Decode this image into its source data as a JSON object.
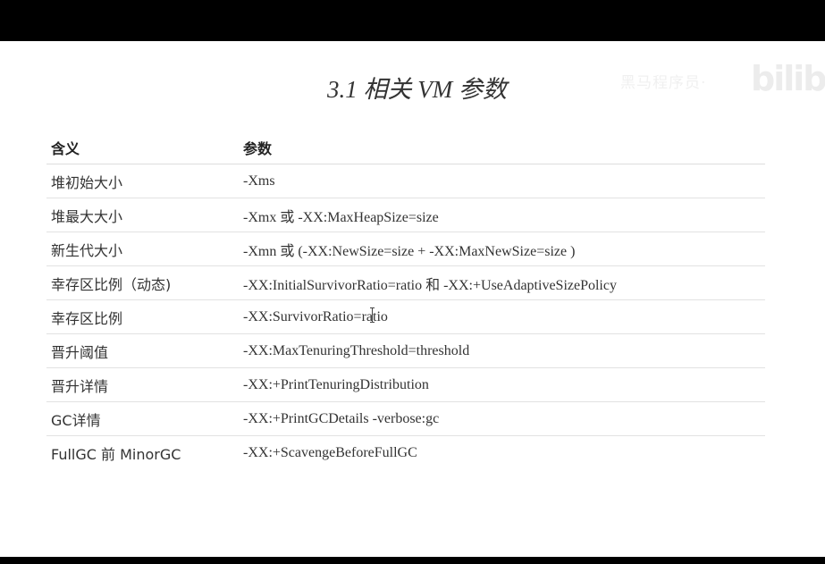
{
  "watermark": {
    "text": "黑马程序员·",
    "logo": "bilibili"
  },
  "title": "3.1 相关 VM 参数",
  "table": {
    "headers": [
      "含义",
      "参数"
    ],
    "rows": [
      {
        "meaning": "堆初始大小",
        "param": "-Xms"
      },
      {
        "meaning": "堆最大大小",
        "param": "-Xmx 或 -XX:MaxHeapSize=size"
      },
      {
        "meaning": "新生代大小",
        "param": "-Xmn 或 (-XX:NewSize=size + -XX:MaxNewSize=size )"
      },
      {
        "meaning": "幸存区比例（动态)",
        "param": "-XX:InitialSurvivorRatio=ratio 和 -XX:+UseAdaptiveSizePolicy"
      },
      {
        "meaning": "幸存区比例",
        "param": "-XX:SurvivorRatio=ratio"
      },
      {
        "meaning": "晋升阈值",
        "param": "-XX:MaxTenuringThreshold=threshold"
      },
      {
        "meaning": "晋升详情",
        "param": "-XX:+PrintTenuringDistribution"
      },
      {
        "meaning": "GC详情",
        "param": "-XX:+PrintGCDetails -verbose:gc"
      },
      {
        "meaning": "FullGC 前 MinorGC",
        "param": "-XX:+ScavengeBeforeFullGC"
      }
    ]
  },
  "colors": {
    "letterbox": "#000000",
    "text": "#333333",
    "row_border": "#e2e2e2"
  }
}
